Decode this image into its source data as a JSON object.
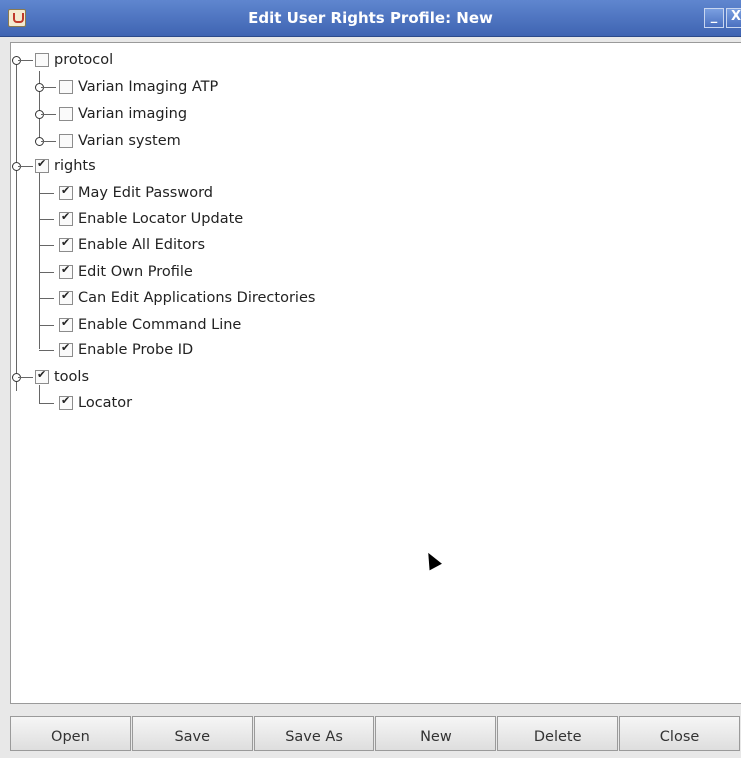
{
  "window": {
    "title": "Edit User Rights Profile: New",
    "minimize_label": "_",
    "close_label": "X"
  },
  "tree": {
    "protocol": {
      "label": "protocol",
      "checked": false,
      "children": [
        {
          "label": "Varian Imaging ATP",
          "checked": false
        },
        {
          "label": "Varian imaging",
          "checked": false
        },
        {
          "label": "Varian system",
          "checked": false
        }
      ]
    },
    "rights": {
      "label": "rights",
      "checked": true,
      "children": [
        {
          "label": "May Edit Password",
          "checked": true
        },
        {
          "label": "Enable Locator Update",
          "checked": true
        },
        {
          "label": "Enable All Editors",
          "checked": true
        },
        {
          "label": "Edit Own Profile",
          "checked": true
        },
        {
          "label": "Can Edit Applications Directories",
          "checked": true
        },
        {
          "label": "Enable Command Line",
          "checked": true
        },
        {
          "label": "Enable Probe ID",
          "checked": true
        }
      ]
    },
    "tools": {
      "label": "tools",
      "checked": true,
      "children": [
        {
          "label": "Locator",
          "checked": true
        }
      ]
    }
  },
  "buttons": {
    "open": "Open",
    "save": "Save",
    "save_as": "Save As",
    "new": "New",
    "delete": "Delete",
    "close": "Close"
  }
}
